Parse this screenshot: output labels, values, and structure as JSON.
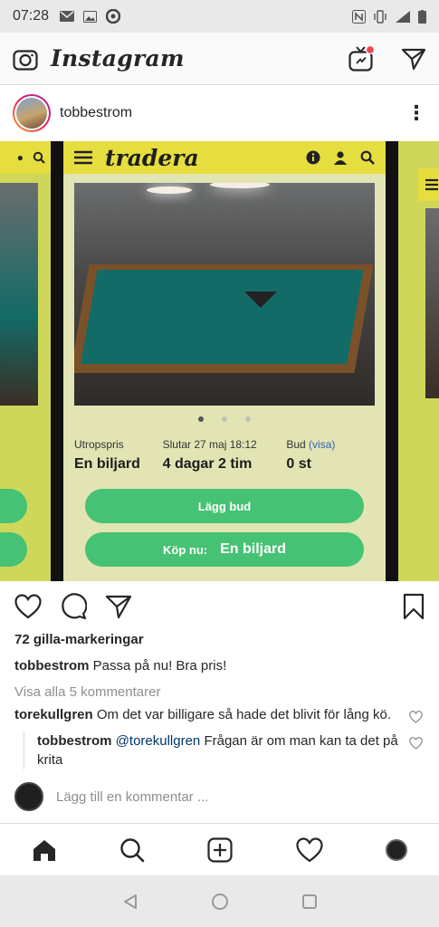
{
  "status_bar": {
    "time": "07:28"
  },
  "header": {
    "app_title": "Instagram",
    "icons": [
      "camera-icon",
      "igtv-icon",
      "direct-message-icon"
    ],
    "accent_color": "#ed4956"
  },
  "post": {
    "username": "tobbestrom",
    "media": {
      "brand": "tradera",
      "info": {
        "start_label": "Utropspris",
        "start_value": "En biljard",
        "ends_label": "Slutar",
        "ends_date": "27 maj 18:12",
        "ends_value": "4 dagar 2 tim",
        "bid_label": "Bud",
        "bid_link": "(visa)",
        "bid_value": "0 st"
      },
      "bid_button": "Lägg bud",
      "buy_label": "Köp nu:",
      "buy_value": "En biljard",
      "brand_color": "#e6dd3f",
      "button_color": "#46c274",
      "carousel_active": 1,
      "carousel_count": 3
    },
    "likes": "72 gilla-markeringar",
    "caption": {
      "user": "tobbestrom",
      "text": "Passa på nu! Bra pris!"
    },
    "view_all": "Visa alla 5 kommentarer",
    "comments": [
      {
        "user": "torekullgren",
        "text": "Om det var billigare så hade det blivit för lång kö."
      }
    ],
    "reply": {
      "user": "tobbestrom",
      "mention": "@torekullgren",
      "text": "Frågan är om man kan ta det på krita"
    },
    "add_comment_placeholder": "Lägg till en kommentar ..."
  },
  "bottom_nav": [
    "home-icon",
    "search-icon",
    "add-post-icon",
    "activity-heart-icon",
    "profile-avatar"
  ]
}
